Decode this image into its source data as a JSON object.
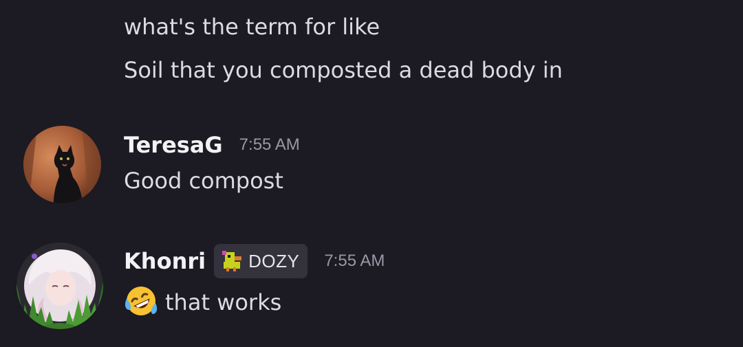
{
  "messages": {
    "continued": [
      {
        "text": "what's the term for like"
      },
      {
        "text": "Soil that you composted a dead body in"
      }
    ],
    "teresa": {
      "username": "TeresaG",
      "timestamp": "7:55 AM",
      "text": "Good compost",
      "avatar_icon": "black-cat-avatar"
    },
    "khonri": {
      "username": "Khonri",
      "tag": "DOZY",
      "timestamp": "7:55 AM",
      "emoji": "rolling-on-floor-laughing",
      "text": "that works",
      "avatar_icon": "anime-character-avatar"
    }
  },
  "colors": {
    "background": "#1c1a22",
    "text": "#dcdbe2",
    "timestamp": "#9a98a6",
    "tag_background": "#34323d"
  }
}
